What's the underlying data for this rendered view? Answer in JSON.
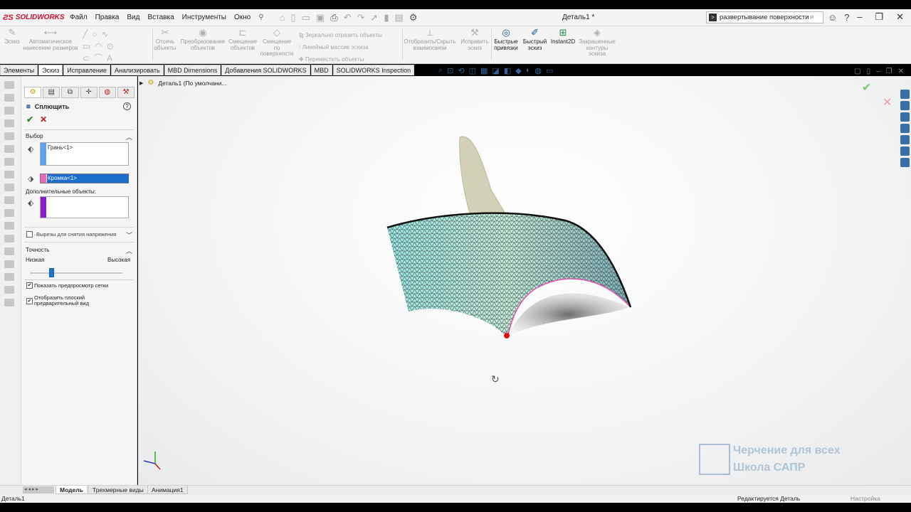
{
  "app": {
    "logo_text": "SOLIDWORKS",
    "menu": [
      "Файл",
      "Правка",
      "Вид",
      "Вставка",
      "Инструменты",
      "Окно"
    ],
    "document_title": "Деталь1 *",
    "search_value": "развертывание поверхности"
  },
  "ribbon": {
    "sketch": "Эскиз",
    "smart_dimension": "Автоматическое нанесение размеров",
    "trim": "Отсечь объекты",
    "convert": "Преобразование объектов",
    "offset": "Смещение объектов",
    "offset_surface": "Смещение по поверхности",
    "mirror": "Зеркально отразить объекты",
    "linear_pattern": "Линейный массив эскиза",
    "move": "Переместить объекты",
    "show_hide": "Отобразить/Скрыть взаимосвязи",
    "repair": "Исправить эскиз",
    "quick_snaps": "Быстрые привязки",
    "rapid_sketch": "Быстрый эскиз",
    "instant2d": "Instant2D",
    "shaded_contours": "Закрашенные контуры эскиза"
  },
  "tabs": [
    "Элементы",
    "Эскиз",
    "Исправление",
    "Анализировать",
    "MBD Dimensions",
    "Добавления SOLIDWORKS",
    "MBD",
    "SOLIDWORKS Inspection"
  ],
  "active_tab": "Эскиз",
  "property_manager": {
    "title": "Сплющить",
    "ok": "✔",
    "cancel": "✕",
    "help": "?",
    "selection_header": "Выбор",
    "face_value": "Грань<1>",
    "edge_value": "Кромка<1>",
    "additional_label": "Дополнительные объекты:",
    "relief_cuts": "Вырезы для снятия напряжения",
    "accuracy_header": "Точность",
    "low": "Низкая",
    "high": "Высокая",
    "accuracy_level": 0.25,
    "show_mesh": "Показать предпросмотр сетки",
    "show_flat": "Отобразить плоский предварительный вид",
    "show_mesh_checked": true,
    "show_flat_checked": true,
    "relief_checked": false
  },
  "viewport": {
    "tree_item": "Деталь1  (По умолчани..."
  },
  "watermark": {
    "line1": "Черчение для всех",
    "line2": "Школа САПР"
  },
  "bottom_tabs": [
    "Модель",
    "Трехмерные виды",
    "Анимация1"
  ],
  "status": {
    "left": "Деталь1",
    "middle": "Редактируется Деталь",
    "right": "Настройка"
  },
  "colors": {
    "face_bar": "#5ea3f0",
    "edge_bar": "#e869b8",
    "extra_bar": "#8a1ad6",
    "accent": "#1c6ecd"
  }
}
